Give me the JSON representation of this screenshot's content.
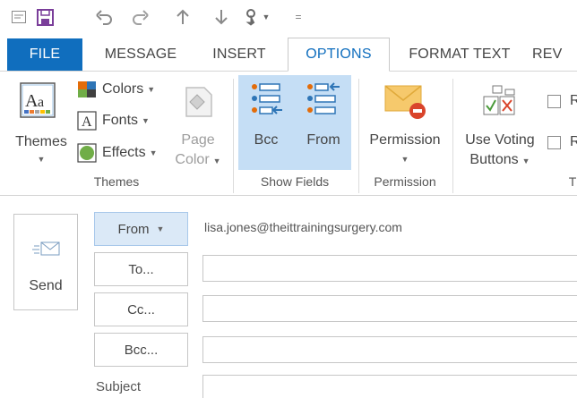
{
  "quick_access": {
    "icons": [
      "window-icon",
      "save-icon",
      "undo-icon",
      "redo-icon",
      "up-arrow-icon",
      "down-arrow-icon",
      "touch-mode-icon",
      "customize-icon"
    ]
  },
  "tabs": [
    {
      "label": "FILE"
    },
    {
      "label": "MESSAGE"
    },
    {
      "label": "INSERT"
    },
    {
      "label": "OPTIONS"
    },
    {
      "label": "FORMAT TEXT"
    },
    {
      "label": "REV"
    }
  ],
  "ribbon": {
    "themes_group": {
      "themes_label": "Themes",
      "colors_label": "Colors",
      "fonts_label": "Fonts",
      "effects_label": "Effects",
      "page_color_line1": "Page",
      "page_color_line2": "Color",
      "group_label": "Themes"
    },
    "show_fields_group": {
      "bcc_label": "Bcc",
      "from_label": "From",
      "group_label": "Show Fields"
    },
    "permission_group": {
      "permission_label": "Permission",
      "group_label": "Permission"
    },
    "tracking_group": {
      "voting_line1": "Use Voting",
      "voting_line2": "Buttons",
      "check1_label": "R",
      "check2_label": "R",
      "group_label": "T"
    }
  },
  "compose": {
    "send_label": "Send",
    "from_button": "From",
    "from_value": "lisa.jones@theittrainingsurgery.com",
    "to_button": "To...",
    "cc_button": "Cc...",
    "bcc_button": "Bcc...",
    "subject_label": "Subject"
  },
  "colors": {
    "accent": "#106ebe",
    "file_tab": "#106ebe",
    "show_fields_highlight": "#c5def5"
  }
}
